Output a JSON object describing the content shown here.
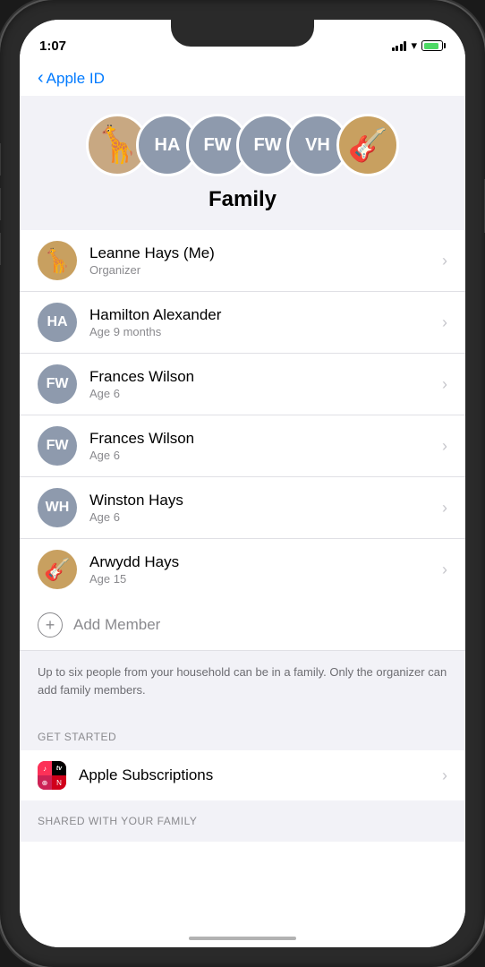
{
  "status": {
    "time": "1:07",
    "location_icon": "▲"
  },
  "nav": {
    "back_label": "Apple ID"
  },
  "family_section": {
    "title": "Family",
    "avatars": [
      {
        "type": "photo",
        "emoji": "🦒",
        "label": "Leanne"
      },
      {
        "type": "initials",
        "text": "HA",
        "label": "Hamilton"
      },
      {
        "type": "initials",
        "text": "FW",
        "label": "Frances 1"
      },
      {
        "type": "initials",
        "text": "FW",
        "label": "Frances 2"
      },
      {
        "type": "initials",
        "text": "VH",
        "label": "Winston"
      },
      {
        "type": "photo",
        "emoji": "🎸",
        "label": "Arwydd"
      }
    ]
  },
  "members": [
    {
      "name": "Leanne Hays  (Me)",
      "sub": "Organizer",
      "avatar_type": "photo",
      "avatar_emoji": "🦒",
      "initials": ""
    },
    {
      "name": "Hamilton Alexander",
      "sub": "Age 9 months",
      "avatar_type": "initials",
      "initials": "HA"
    },
    {
      "name": "Frances Wilson",
      "sub": "Age 6",
      "avatar_type": "initials",
      "initials": "FW"
    },
    {
      "name": "Frances Wilson",
      "sub": "Age 6",
      "avatar_type": "initials",
      "initials": "FW"
    },
    {
      "name": "Winston Hays",
      "sub": "Age 6",
      "avatar_type": "initials",
      "initials": "WH"
    },
    {
      "name": "Arwydd Hays",
      "sub": "Age 15",
      "avatar_type": "photo",
      "avatar_emoji": "🎸"
    }
  ],
  "add_member": {
    "label": "Add Member"
  },
  "info": {
    "text": "Up to six people from your household can be in a family. Only the organizer can add family members."
  },
  "get_started": {
    "section_label": "GET STARTED",
    "subscriptions_label": "Apple Subscriptions"
  },
  "shared_footer": {
    "label": "SHARED WITH YOUR FAMILY"
  }
}
